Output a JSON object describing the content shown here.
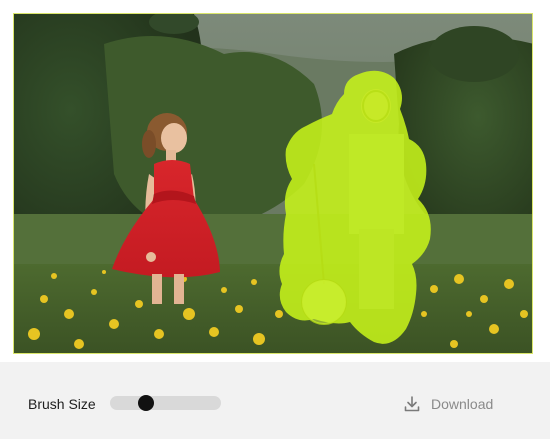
{
  "toolbar": {
    "brush_size_label": "Brush Size",
    "brush_size_value": 0.32,
    "download_label": "Download",
    "download_icon": "download-icon"
  },
  "mask": {
    "color": "#c6f21a"
  },
  "photo": {
    "description_icon": "photo-canvas"
  }
}
